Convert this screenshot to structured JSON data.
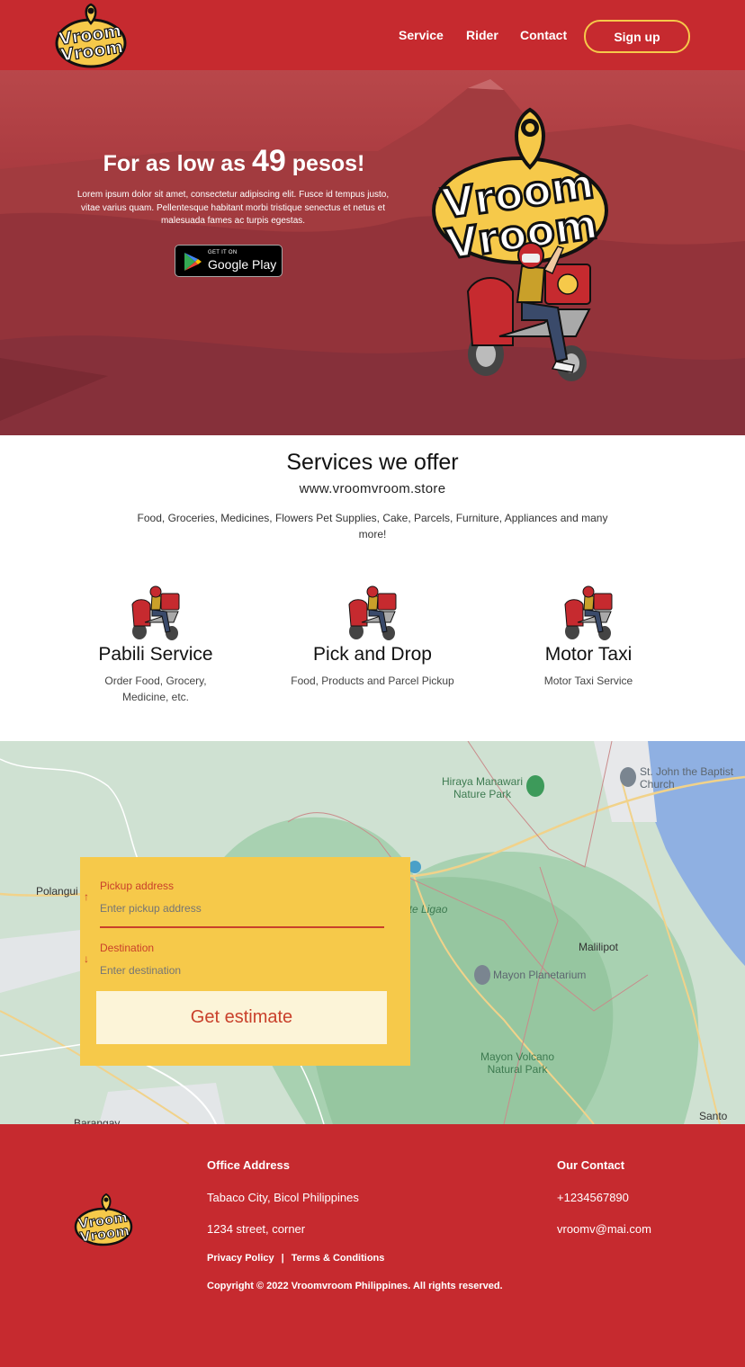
{
  "colors": {
    "brand_red": "#c62a2f",
    "brand_yellow": "#f6c94a",
    "map_green": "#cfe1d2"
  },
  "header": {
    "logo_text_line1": "Vroom",
    "logo_text_line2": "Vroom",
    "nav": {
      "service": "Service",
      "rider": "Rider",
      "contact": "Contact"
    },
    "signup": "Sign up"
  },
  "hero": {
    "title_prefix": "For as low as",
    "title_number": "49",
    "title_suffix": "pesos!",
    "description": "Lorem ipsum dolor sit amet, consectetur adipiscing elit. Fusce id tempus justo, vitae varius quam. Pellentesque habitant morbi tristique senectus et netus et malesuada fames ac turpis egestas.",
    "google_play_small": "GET IT ON",
    "google_play_big": "Google Play",
    "logo_text_line1": "Vroom",
    "logo_text_line2": "Vroom"
  },
  "services": {
    "title": "Services we offer",
    "url": "www.vroomvroom.store",
    "description": "Food, Groceries, Medicines, Flowers Pet Supplies, Cake, Parcels, Furniture, Appliances and many more!",
    "items": [
      {
        "name": "Pabili Service",
        "sub": "Order Food, Grocery, Medicine, etc.",
        "icon": "rider-icon"
      },
      {
        "name": "Pick and Drop",
        "sub": "Food, Products and Parcel Pickup",
        "icon": "rider-icon"
      },
      {
        "name": "Motor Taxi",
        "sub": "Motor Taxi Service",
        "icon": "rider-icon"
      }
    ]
  },
  "map": {
    "labels": {
      "hiraya": "Hiraya Manawari Nature Park",
      "st_john": "St. John the Baptist Church",
      "polangui": "Polangui",
      "ligao": "ite Ligao",
      "malilipot": "Malilipot",
      "planetarium": "Mayon Planetarium",
      "mayon": "Mayon Volcano Natural Park",
      "barangay": "Barangay",
      "santo": "Santo"
    }
  },
  "estimate": {
    "pickup_label": "Pickup address",
    "pickup_placeholder": "Enter pickup address",
    "destination_label": "Destination",
    "destination_placeholder": "Enter destination",
    "button": "Get estimate"
  },
  "footer": {
    "office_heading": "Office Address",
    "address_line1": "Tabaco City, Bicol Philippines",
    "address_line2": "1234 street, corner",
    "contact_heading": "Our Contact",
    "phone": "+1234567890",
    "email": "vroomv@mai.com",
    "privacy": "Privacy Policy",
    "separator": "|",
    "terms": "Terms & Conditions",
    "copyright": "Copyright © 2022  Vroomvroom Philippines. All rights reserved."
  }
}
